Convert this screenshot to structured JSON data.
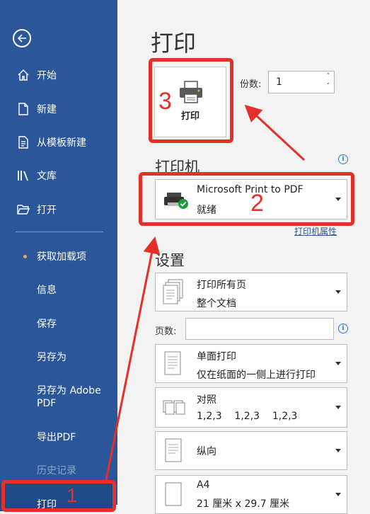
{
  "sidebar": {
    "items": [
      {
        "label": "开始",
        "icon": "home-icon"
      },
      {
        "label": "新建",
        "icon": "new-document-icon"
      },
      {
        "label": "从模板新建",
        "icon": "template-icon"
      },
      {
        "label": "文库",
        "icon": "library-icon"
      },
      {
        "label": "打开",
        "icon": "folder-open-icon"
      }
    ],
    "items2": [
      "获取加载项",
      "信息",
      "保存",
      "另存为",
      "另存为 Adobe PDF",
      "导出PDF",
      "历史记录"
    ],
    "active": "打印"
  },
  "main": {
    "title": "打印",
    "print_button": "打印",
    "copies_label": "份数:",
    "copies_value": "1",
    "printer_heading": "打印机",
    "printer_name": "Microsoft Print to PDF",
    "printer_status": "就绪",
    "printer_properties": "打印机属性",
    "settings_heading": "设置",
    "print_range": {
      "title": "打印所有页",
      "sub": "整个文档"
    },
    "pages_label": "页数:",
    "pages_value": "",
    "sides": {
      "title": "单面打印",
      "sub": "仅在纸面的一侧上进行打印"
    },
    "collate": {
      "title": "对照",
      "sub": "1,2,3    1,2,3    1,2,3"
    },
    "orientation": {
      "title": "纵向"
    },
    "paper": {
      "title": "A4",
      "sub": "21 厘米 x 29.7 厘米"
    }
  },
  "annotations": {
    "n1": "1",
    "n2": "2",
    "n3": "3",
    "color": "#e5302a"
  }
}
